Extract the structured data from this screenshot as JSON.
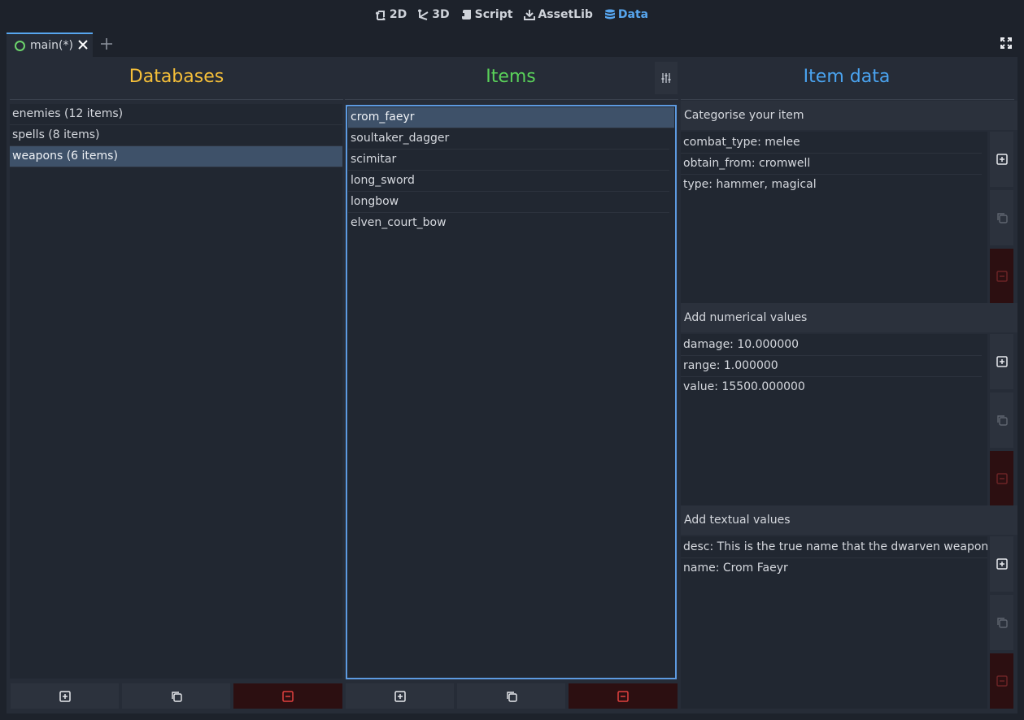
{
  "toolbar": {
    "items": [
      {
        "label": "2D",
        "icon": "2d-icon"
      },
      {
        "label": "3D",
        "icon": "3d-icon"
      },
      {
        "label": "Script",
        "icon": "script-icon"
      },
      {
        "label": "AssetLib",
        "icon": "assetlib-icon"
      },
      {
        "label": "Data",
        "icon": "database-icon",
        "active": true
      }
    ]
  },
  "scene_tabs": [
    {
      "label": "main(*)"
    }
  ],
  "databases": {
    "title": "Databases",
    "title_color": "#f5bf39",
    "items": [
      "enemies (12 items)",
      "spells (8 items)",
      "weapons (6 items)"
    ],
    "selected_index": 2
  },
  "items": {
    "title": "Items",
    "title_color": "#5ad25a",
    "items": [
      "crom_faeyr",
      "soultaker_dagger",
      "scimitar",
      "long_sword",
      "longbow",
      "elven_court_bow"
    ],
    "selected_index": 0
  },
  "item_data": {
    "title": "Item data",
    "title_color": "#4aa3ef",
    "categories": {
      "label": "Categorise your item",
      "items": [
        "combat_type: melee",
        "obtain_from: cromwell",
        "type: hammer, magical"
      ]
    },
    "numerical": {
      "label": "Add numerical values",
      "items": [
        "damage: 10.000000",
        "range: 1.000000",
        "value: 15500.000000"
      ]
    },
    "textual": {
      "label": "Add textual values",
      "items": [
        "desc: This is the true name that the dwarven weapon smiths",
        "name: Crom Faeyr"
      ]
    }
  },
  "colors": {
    "accent": "#57a6ef",
    "danger_bg": "#2c0f11",
    "danger_icon": "#e2413f"
  }
}
